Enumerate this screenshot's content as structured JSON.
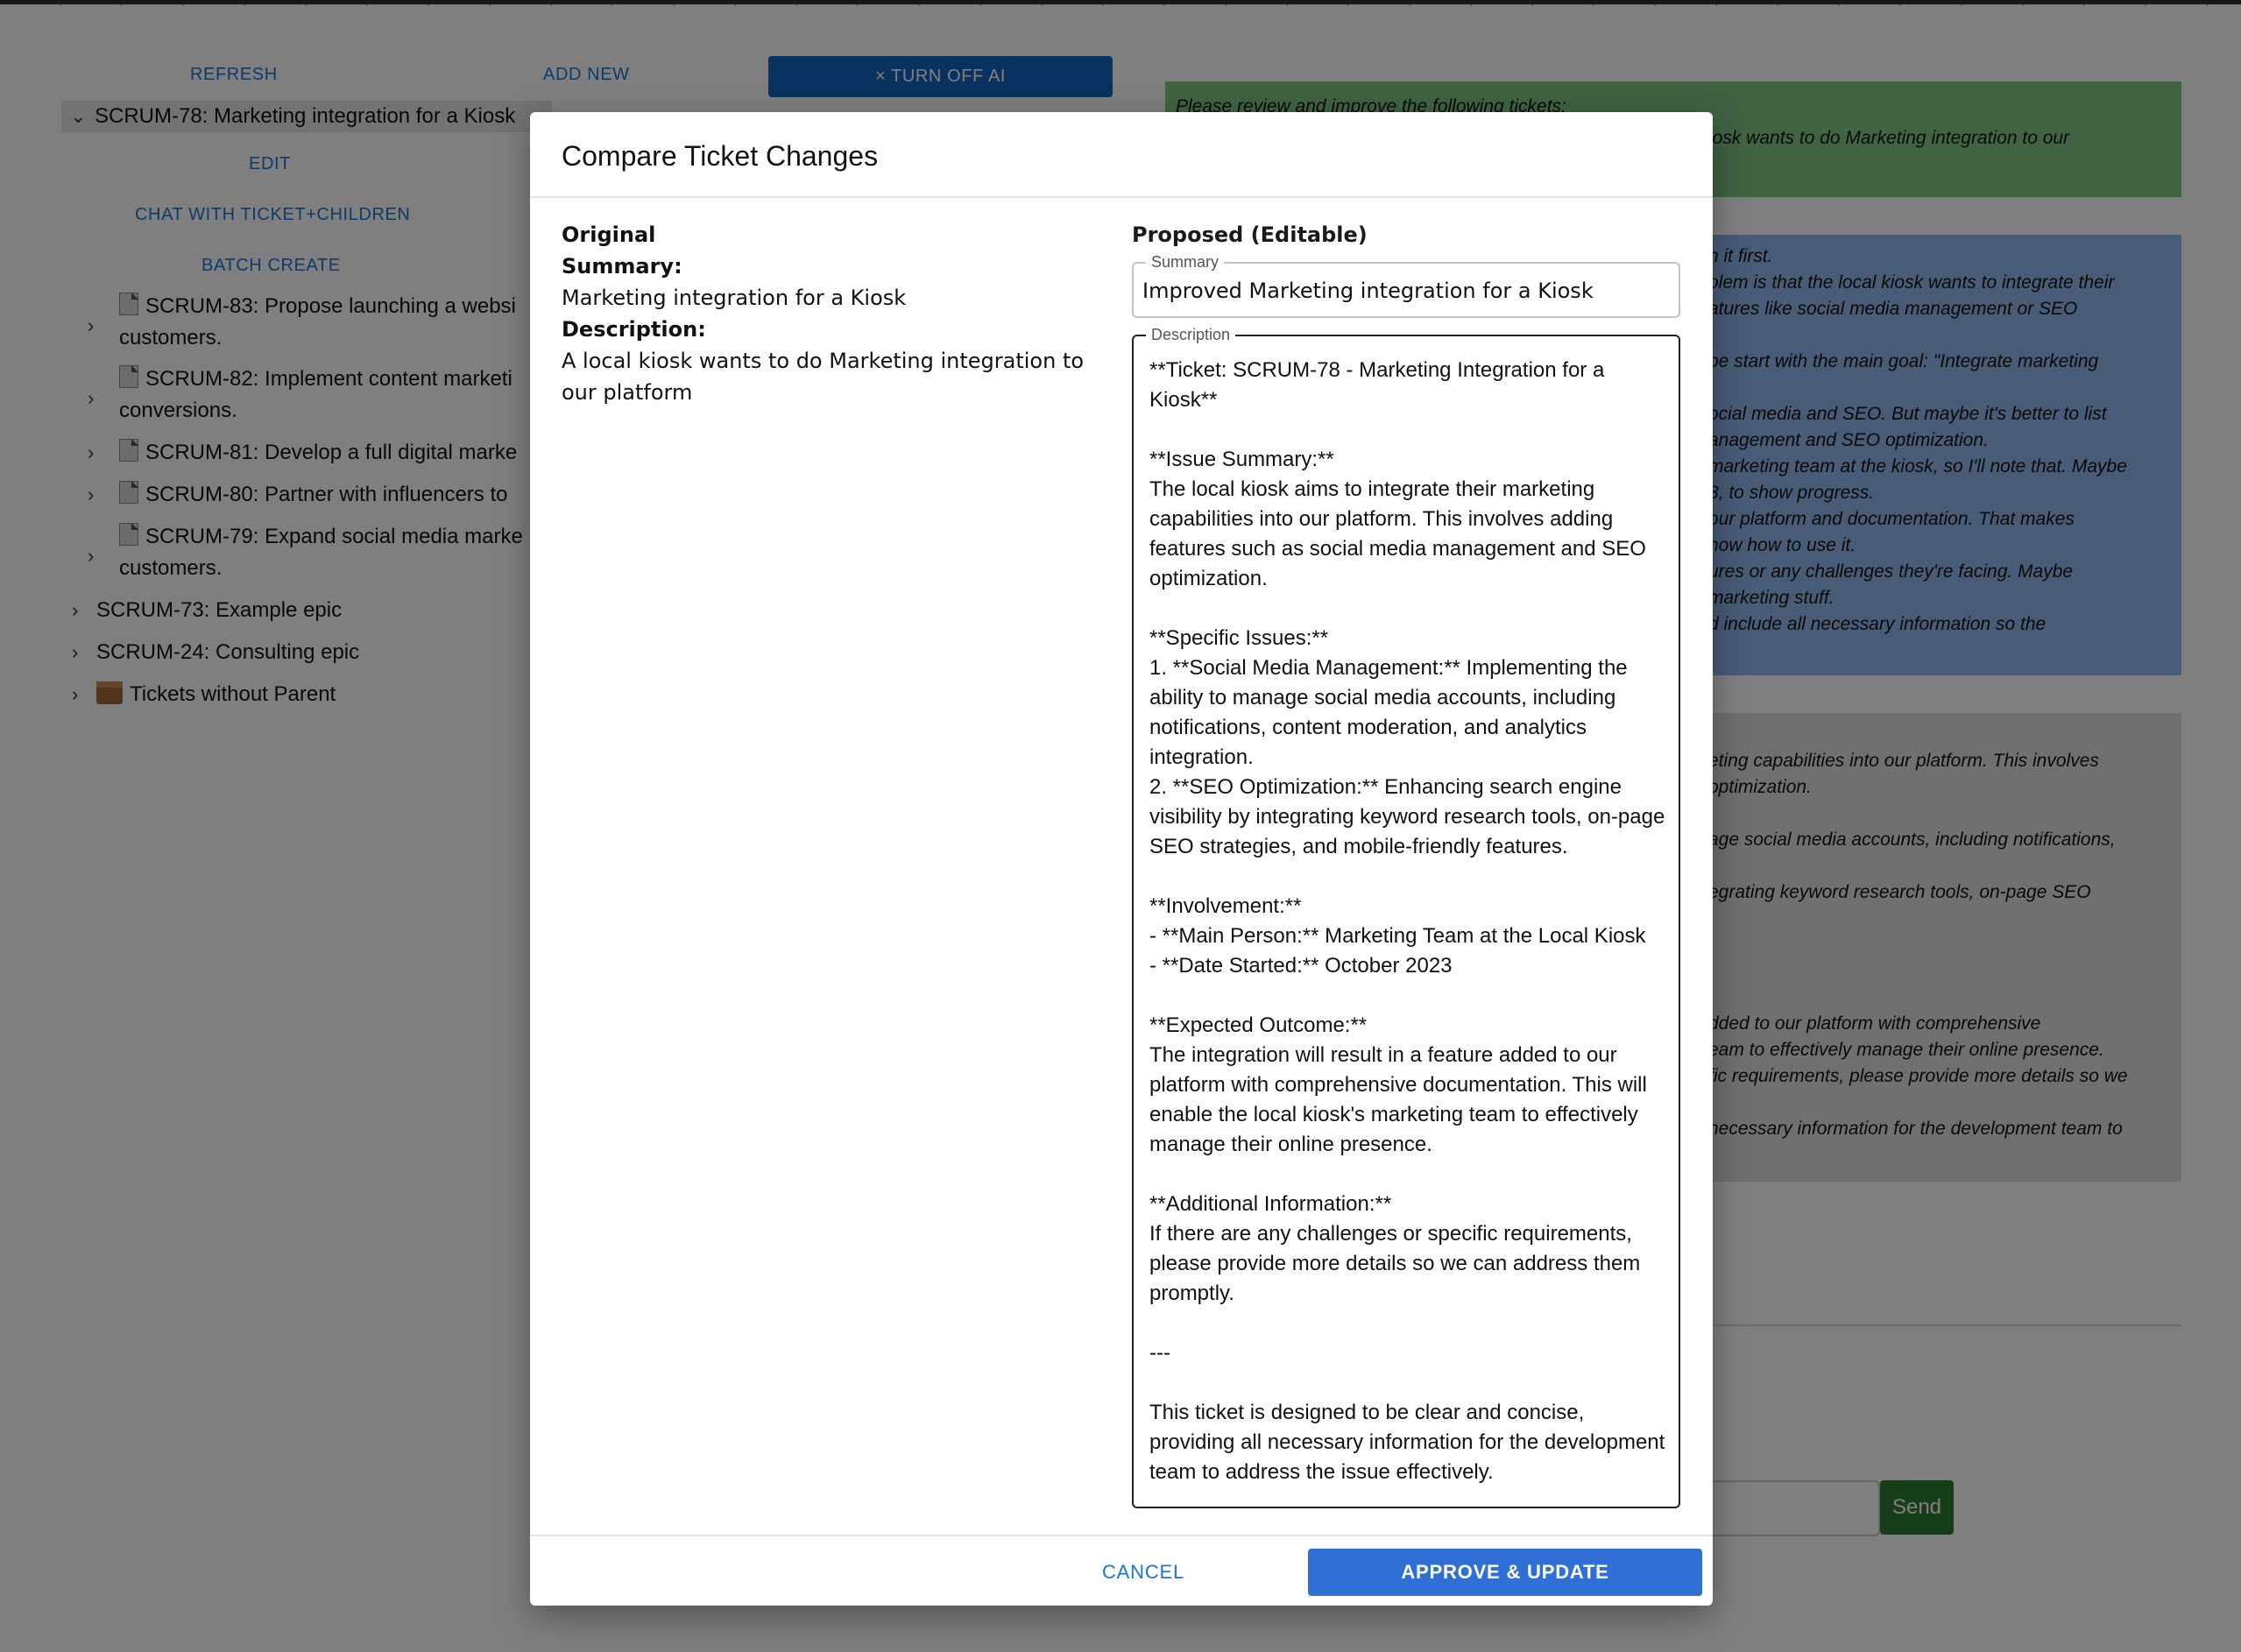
{
  "toolbar": {
    "refresh_label": "REFRESH",
    "add_new_label": "ADD NEW",
    "turn_off_ai_label": "× TURN OFF AI"
  },
  "tree": {
    "root": {
      "key": "SCRUM-78",
      "label": "SCRUM-78: Marketing integration for a Kiosk"
    },
    "actions": {
      "edit": "EDIT",
      "chat": "CHAT WITH TICKET+CHILDREN",
      "batch_create": "BATCH CREATE"
    },
    "children": [
      {
        "line1": "SCRUM-83: Propose launching a websi",
        "line2": "customers."
      },
      {
        "line1": "SCRUM-82: Implement content marketi",
        "line2": "conversions."
      },
      {
        "line1": "SCRUM-81: Develop a full digital marke",
        "line2": ""
      },
      {
        "line1": "SCRUM-80: Partner with influencers to",
        "line2": ""
      },
      {
        "line1": "SCRUM-79: Expand social media marke",
        "line2": "customers."
      }
    ],
    "epics": [
      {
        "label": "SCRUM-73: Example epic"
      },
      {
        "label": "SCRUM-24: Consulting epic"
      }
    ],
    "no_parent": {
      "label": "Tickets without Parent"
    }
  },
  "chat": {
    "green_lines": [
      "Please review and improve the following tickets:",
      "iosk wants to do Marketing integration to our"
    ],
    "blue_lines": [
      "h it first.",
      "olem is that the local kiosk wants to integrate their",
      "atures like social media management or SEO",
      "be start with the main goal: \"Integrate marketing",
      "ocial media and SEO. But maybe it's better to list",
      "anagement and SEO optimization.",
      "marketing team at the kiosk, so I'll note that. Maybe",
      "3, to show progress.",
      "our platform and documentation. That makes",
      "now how to use it.",
      "ures or any challenges they're facing. Maybe",
      "marketing stuff.",
      "d include all necessary information so the"
    ],
    "gray_lines": [
      "eting capabilities into our platform. This involves",
      "optimization.",
      "age social media accounts, including notifications,",
      "egrating keyword research tools, on-page SEO",
      "dded to our platform with comprehensive",
      "eam to effectively manage their online presence.",
      "fic requirements, please provide more details so we",
      "necessary information for the development team to"
    ],
    "send_label": "Send"
  },
  "modal": {
    "title": "Compare Ticket Changes",
    "original": {
      "heading": "Original",
      "summary_label": "Summary:",
      "summary_value": "Marketing integration for a Kiosk",
      "description_label": "Description:",
      "description_value": "A local kiosk wants to do Marketing integration to our platform"
    },
    "proposed": {
      "heading": "Proposed (Editable)",
      "summary_legend": "Summary",
      "summary_value": "Improved Marketing integration for a Kiosk",
      "description_legend": "Description",
      "description_value": "**Ticket: SCRUM-78 - Marketing Integration for a Kiosk**\n\n**Issue Summary:**\nThe local kiosk aims to integrate their marketing capabilities into our platform. This involves adding features such as social media management and SEO optimization.\n\n**Specific Issues:**\n1. **Social Media Management:** Implementing the ability to manage social media accounts, including notifications, content moderation, and analytics integration.\n2. **SEO Optimization:** Enhancing search engine visibility by integrating keyword research tools, on-page SEO strategies, and mobile-friendly features.\n\n**Involvement:**\n- **Main Person:** Marketing Team at the Local Kiosk\n- **Date Started:** October 2023\n\n**Expected Outcome:**\nThe integration will result in a feature added to our platform with comprehensive documentation. This will enable the local kiosk's marketing team to effectively manage their online presence.\n\n**Additional Information:**\nIf there are any challenges or specific requirements, please provide more details so we can address them promptly.\n\n---\n\nThis ticket is designed to be clear and concise, providing all necessary information for the development team to address the issue effectively."
    },
    "cancel_label": "CANCEL",
    "approve_label": "APPROVE & UPDATE"
  }
}
